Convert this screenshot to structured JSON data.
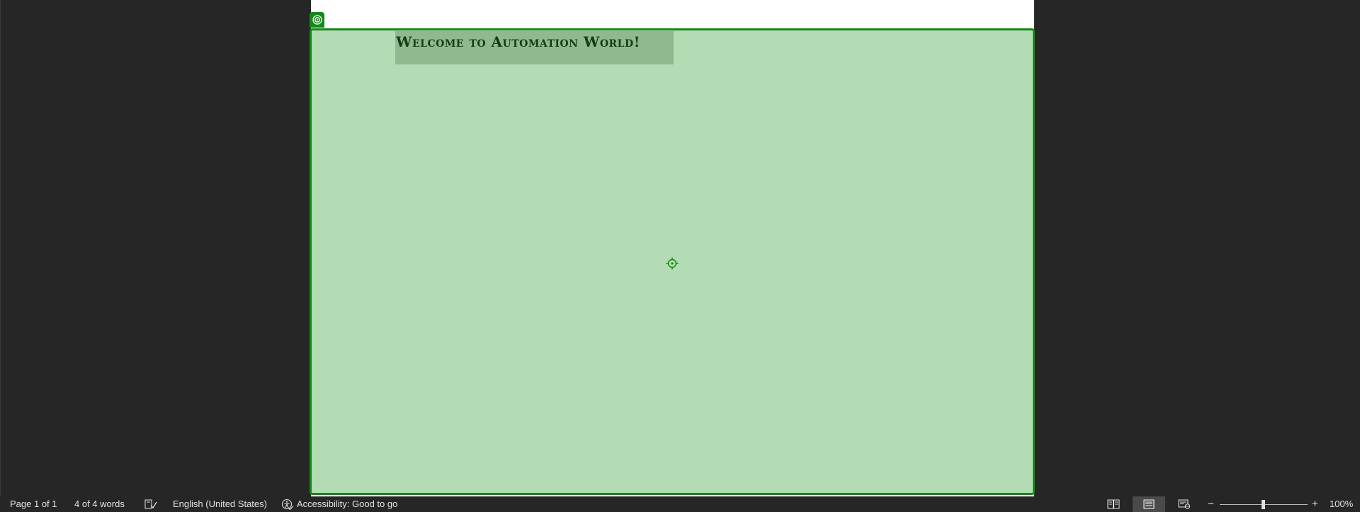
{
  "document": {
    "heading": "Welcome to Automation World!"
  },
  "statusbar": {
    "page": "Page 1 of 1",
    "words": "4 of 4 words",
    "proofing_icon": "proofing-check-icon",
    "language": "English (United States)",
    "accessibility": "Accessibility: Good to go",
    "views": [
      "read-mode-icon",
      "print-layout-icon",
      "web-layout-icon"
    ],
    "active_view": "print-layout",
    "zoom_out": "−",
    "zoom_in": "+",
    "zoom_level": "100%",
    "zoom_fraction": 0.5
  },
  "colors": {
    "selection_fill": "#b3dcb4",
    "selection_border": "#138a17",
    "heading_color": "#123d17"
  }
}
